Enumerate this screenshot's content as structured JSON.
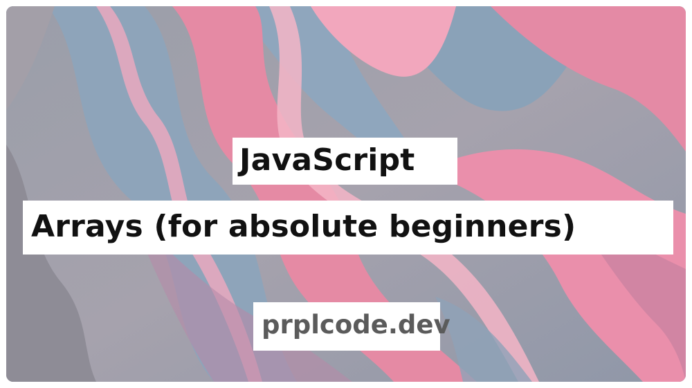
{
  "title": {
    "line1": "JavaScript",
    "line2": "Arrays (for absolute beginners)"
  },
  "site": {
    "label": "prplcode.dev"
  },
  "colors": {
    "pink": "#e98aa6",
    "blue_gray": "#8fa3b8",
    "gray": "#9b9aa4",
    "white": "#ffffff",
    "text": "#111111",
    "subtext": "#5b5b5b"
  }
}
